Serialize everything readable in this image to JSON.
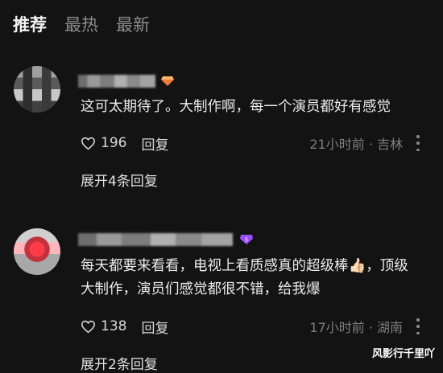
{
  "tabs": [
    {
      "label": "推荐",
      "active": true
    },
    {
      "label": "最热",
      "active": false
    },
    {
      "label": "最新",
      "active": false
    }
  ],
  "comments": [
    {
      "text": "这可太期待了。大制作啊，每一个演员都好有感觉",
      "likes": "196",
      "reply_label": "回复",
      "time_location": "21小时前 · 吉林",
      "expand": "展开4条回复",
      "badge_icon": "diamond-badge-icon"
    },
    {
      "text": "每天都要来看看，电视上看质感真的超级棒👍🏻，顶级大制作，演员们感觉都很不错，给我爆",
      "likes": "138",
      "reply_label": "回复",
      "time_location": "17小时前 · 湖南",
      "expand": "展开2条回复",
      "badge_icon": "level-5-badge-icon"
    }
  ],
  "watermark": "风影行千里吖",
  "colors": {
    "background": "#131313",
    "text": "#ececec",
    "muted": "#7d7d7d",
    "badge_orange": "#f07a3c",
    "badge_purple": "#9b4dff"
  }
}
